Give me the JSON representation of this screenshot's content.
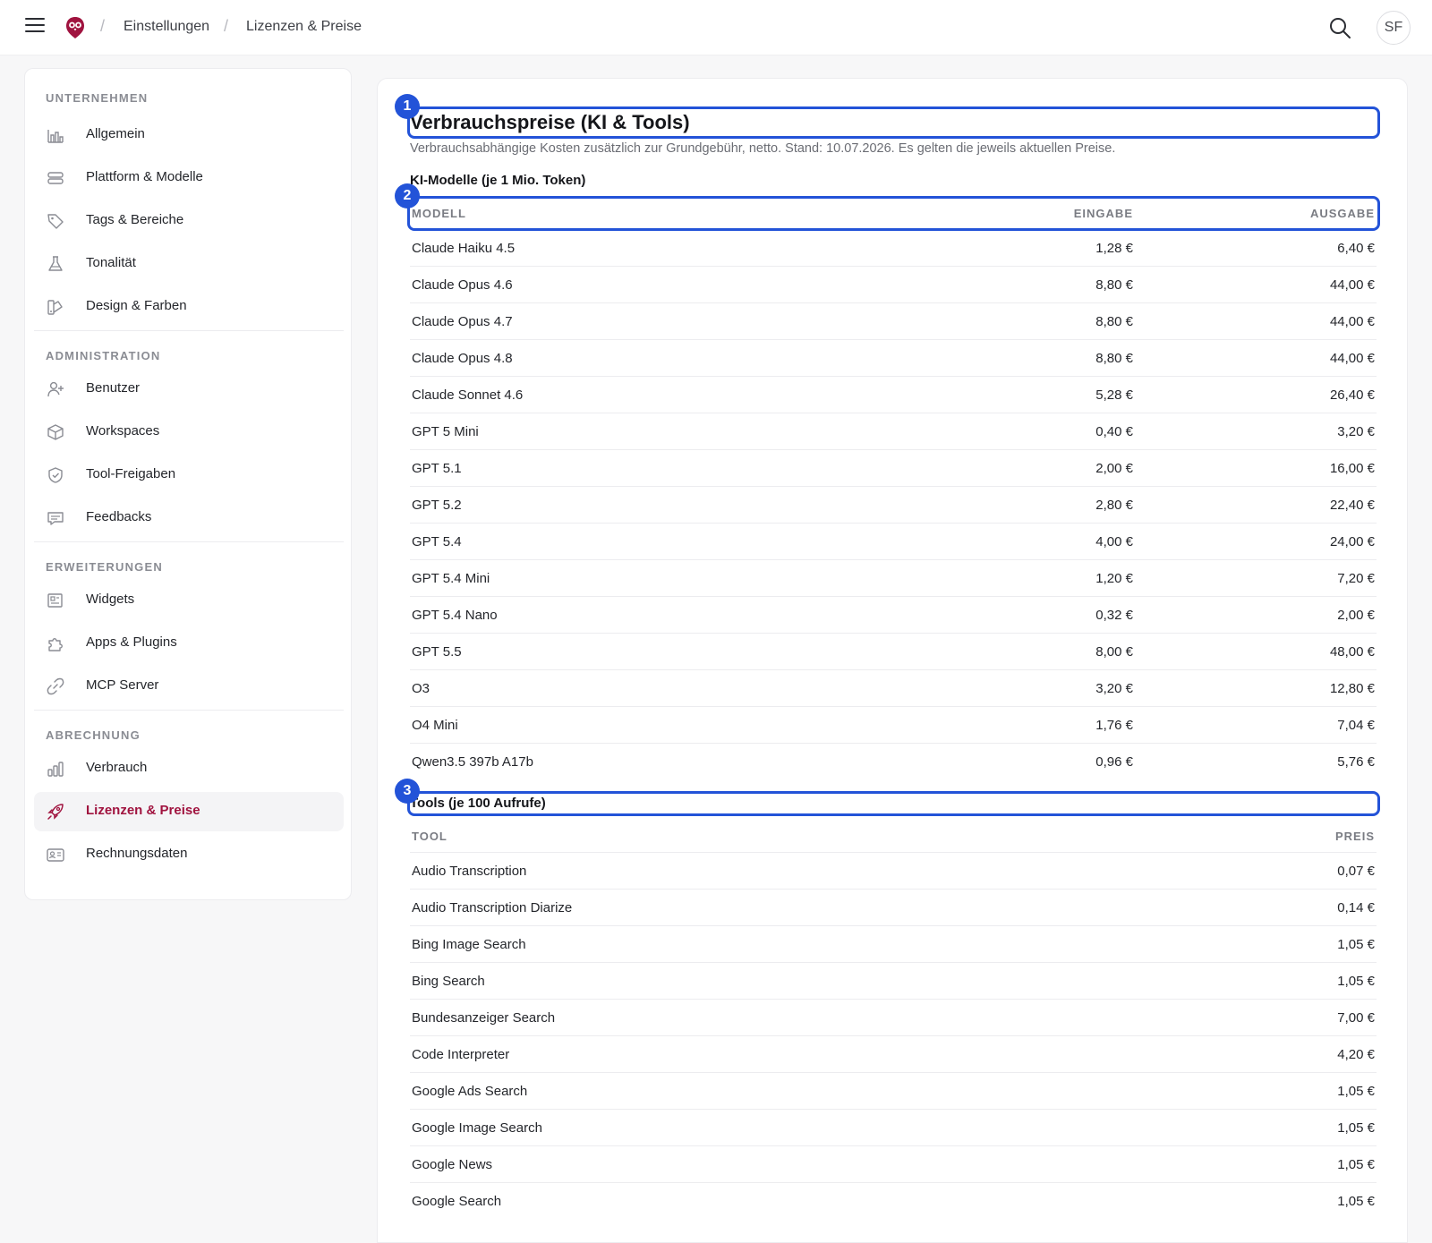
{
  "header": {
    "breadcrumb": [
      "Einstellungen",
      "Lizenzen & Preise"
    ],
    "avatar_initials": "SF"
  },
  "sidebar": {
    "sections": [
      {
        "heading": "UNTERNEHMEN",
        "items": [
          {
            "label": "Allgemein",
            "icon": "building-chart-icon"
          },
          {
            "label": "Plattform & Modelle",
            "icon": "server-stack-icon"
          },
          {
            "label": "Tags & Bereiche",
            "icon": "tag-icon"
          },
          {
            "label": "Tonalität",
            "icon": "flask-icon"
          },
          {
            "label": "Design & Farben",
            "icon": "palette-icon"
          }
        ]
      },
      {
        "heading": "ADMINISTRATION",
        "items": [
          {
            "label": "Benutzer",
            "icon": "user-add-icon"
          },
          {
            "label": "Workspaces",
            "icon": "cube-icon"
          },
          {
            "label": "Tool-Freigaben",
            "icon": "shield-check-icon"
          },
          {
            "label": "Feedbacks",
            "icon": "chat-icon"
          }
        ]
      },
      {
        "heading": "ERWEITERUNGEN",
        "items": [
          {
            "label": "Widgets",
            "icon": "newspaper-icon"
          },
          {
            "label": "Apps & Plugins",
            "icon": "puzzle-icon"
          },
          {
            "label": "MCP Server",
            "icon": "link-icon"
          }
        ]
      },
      {
        "heading": "ABRECHNUNG",
        "items": [
          {
            "label": "Verbrauch",
            "icon": "bar-chart-icon"
          },
          {
            "label": "Lizenzen & Preise",
            "icon": "rocket-icon",
            "active": true
          },
          {
            "label": "Rechnungsdaten",
            "icon": "id-card-icon"
          }
        ]
      }
    ]
  },
  "main": {
    "title": "Verbrauchspreise (KI & Tools)",
    "subtitle": "Verbrauchsabhängige Kosten zusätzlich zur Grundgebühr, netto. Stand: 10.07.2026. Es gelten die jeweils aktuellen Preise.",
    "models": {
      "heading": "KI-Modelle (je 1 Mio. Token)",
      "columns": [
        "MODELL",
        "EINGABE",
        "AUSGABE"
      ],
      "rows": [
        [
          "Claude Haiku 4.5",
          "1,28 €",
          "6,40 €"
        ],
        [
          "Claude Opus 4.6",
          "8,80 €",
          "44,00 €"
        ],
        [
          "Claude Opus 4.7",
          "8,80 €",
          "44,00 €"
        ],
        [
          "Claude Opus 4.8",
          "8,80 €",
          "44,00 €"
        ],
        [
          "Claude Sonnet 4.6",
          "5,28 €",
          "26,40 €"
        ],
        [
          "GPT 5 Mini",
          "0,40 €",
          "3,20 €"
        ],
        [
          "GPT 5.1",
          "2,00 €",
          "16,00 €"
        ],
        [
          "GPT 5.2",
          "2,80 €",
          "22,40 €"
        ],
        [
          "GPT 5.4",
          "4,00 €",
          "24,00 €"
        ],
        [
          "GPT 5.4 Mini",
          "1,20 €",
          "7,20 €"
        ],
        [
          "GPT 5.4 Nano",
          "0,32 €",
          "2,00 €"
        ],
        [
          "GPT 5.5",
          "8,00 €",
          "48,00 €"
        ],
        [
          "O3",
          "3,20 €",
          "12,80 €"
        ],
        [
          "O4 Mini",
          "1,76 €",
          "7,04 €"
        ],
        [
          "Qwen3.5 397b A17b",
          "0,96 €",
          "5,76 €"
        ]
      ]
    },
    "tools": {
      "heading": "Tools (je 100 Aufrufe)",
      "columns": [
        "TOOL",
        "PREIS"
      ],
      "rows": [
        [
          "Audio Transcription",
          "0,07 €"
        ],
        [
          "Audio Transcription Diarize",
          "0,14 €"
        ],
        [
          "Bing Image Search",
          "1,05 €"
        ],
        [
          "Bing Search",
          "1,05 €"
        ],
        [
          "Bundesanzeiger Search",
          "7,00 €"
        ],
        [
          "Code Interpreter",
          "4,20 €"
        ],
        [
          "Google Ads Search",
          "1,05 €"
        ],
        [
          "Google Image Search",
          "1,05 €"
        ],
        [
          "Google News",
          "1,05 €"
        ],
        [
          "Google Search",
          "1,05 €"
        ]
      ]
    },
    "annotations": [
      "1",
      "2",
      "3"
    ]
  },
  "colors": {
    "accent": "#a0133f",
    "highlight": "#2353d8"
  }
}
